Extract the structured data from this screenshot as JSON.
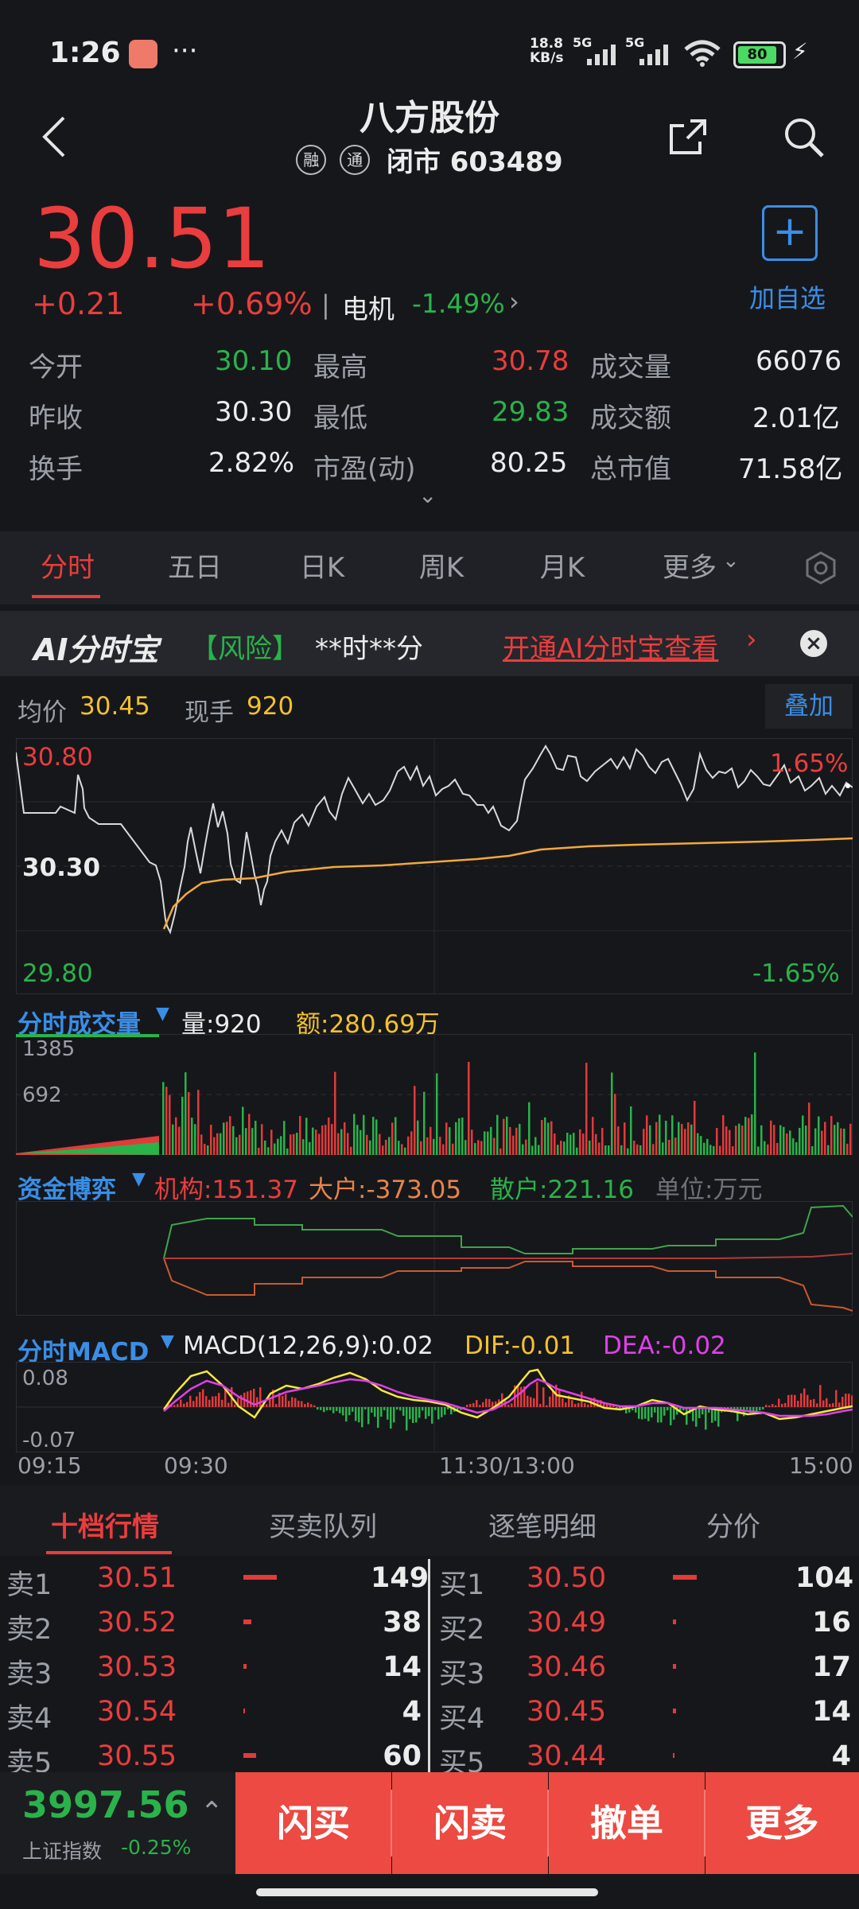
{
  "status_bar": {
    "time": "1:26",
    "net_speed_top": "18.8",
    "net_speed_bottom": "KB/s",
    "sig1": "5G",
    "sig2": "5G",
    "battery": "80"
  },
  "header": {
    "title": "八方股份",
    "tag1": "融",
    "tag2": "通",
    "subtitle": "闭市 603489"
  },
  "quote": {
    "price": "30.51",
    "change": "+0.21",
    "change_pct": "+0.69%",
    "sector": "电机",
    "sector_pct": "-1.49%",
    "add_label": "加自选"
  },
  "stats": {
    "open_label": "今开",
    "open": "30.10",
    "high_label": "最高",
    "high": "30.78",
    "volume_label": "成交量",
    "volume": "66076",
    "prev_close_label": "昨收",
    "prev_close": "30.30",
    "low_label": "最低",
    "low": "29.83",
    "amount_label": "成交额",
    "amount": "2.01亿",
    "turnover_label": "换手",
    "turnover": "2.82%",
    "pe_label": "市盈(动)",
    "pe": "80.25",
    "mcap_label": "总市值",
    "mcap": "71.58亿"
  },
  "tabs": [
    "分时",
    "五日",
    "日K",
    "周K",
    "月K",
    "更多"
  ],
  "banner": {
    "logo": "AI分时宝",
    "risk": "【风险】",
    "time": "**时**分",
    "cta": "开通AI分时宝查看"
  },
  "intraday": {
    "avg_label": "均价",
    "avg": "30.45",
    "last_vol_label": "现手",
    "last_vol": "920",
    "overlay_label": "叠加",
    "price_top": "30.80",
    "price_mid": "30.30",
    "price_bottom": "29.80",
    "pct_top": "1.65%",
    "pct_bottom": "-1.65%"
  },
  "volume_panel": {
    "title": "分时成交量",
    "vol_label": "量:920",
    "amt_label": "额:280.69万",
    "tick_top": "1385",
    "tick_mid": "692"
  },
  "fund_panel": {
    "title": "资金博弈",
    "inst": "机构:151.37",
    "big": "大户:-373.05",
    "retail": "散户:221.16",
    "unit": "单位:万元"
  },
  "macd_panel": {
    "title": "分时MACD",
    "macd": "MACD(12,26,9):0.02",
    "dif": "DIF:-0.01",
    "dea": "DEA:-0.02",
    "tick_top": "0.08",
    "tick_bottom": "-0.07"
  },
  "time_axis": [
    "09:15",
    "09:30",
    "11:30/13:00",
    "15:00"
  ],
  "book_tabs": [
    "十档行情",
    "买卖队列",
    "逐笔明细",
    "分价"
  ],
  "asks": [
    {
      "label": "卖1",
      "price": "30.51",
      "vol": "149"
    },
    {
      "label": "卖2",
      "price": "30.52",
      "vol": "38"
    },
    {
      "label": "卖3",
      "price": "30.53",
      "vol": "14"
    },
    {
      "label": "卖4",
      "price": "30.54",
      "vol": "4"
    },
    {
      "label": "卖5",
      "price": "30.55",
      "vol": "60"
    }
  ],
  "bids": [
    {
      "label": "买1",
      "price": "30.50",
      "vol": "104"
    },
    {
      "label": "买2",
      "price": "30.49",
      "vol": "16"
    },
    {
      "label": "买3",
      "price": "30.46",
      "vol": "17"
    },
    {
      "label": "买4",
      "price": "30.45",
      "vol": "14"
    },
    {
      "label": "买5",
      "price": "30.44",
      "vol": "4"
    }
  ],
  "index": {
    "value": "3997.56",
    "name": "上证指数",
    "change": "-0.25%"
  },
  "actions": [
    "闪买",
    "闪卖",
    "撤单",
    "更多"
  ],
  "colors": {
    "up": "#ea3d3d",
    "down": "#29b34a",
    "accent": "#3a8ee6",
    "action": "#ec4a42"
  }
}
